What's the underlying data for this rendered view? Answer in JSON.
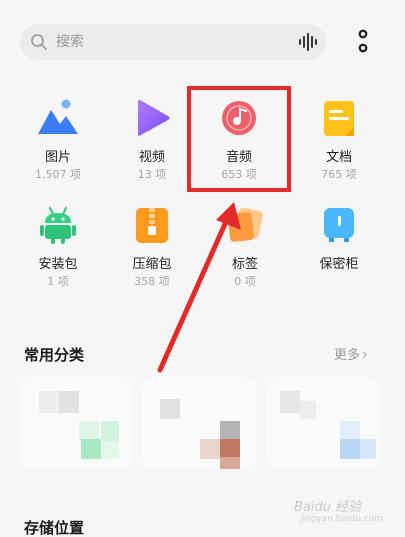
{
  "search": {
    "placeholder": "搜索"
  },
  "categories": [
    {
      "label": "图片",
      "count": "1,507 项",
      "icon": "image-icon"
    },
    {
      "label": "视频",
      "count": "13 项",
      "icon": "video-icon"
    },
    {
      "label": "音频",
      "count": "653 项",
      "icon": "audio-icon"
    },
    {
      "label": "文档",
      "count": "765 项",
      "icon": "document-icon"
    },
    {
      "label": "安装包",
      "count": "1 项",
      "icon": "android-package-icon"
    },
    {
      "label": "压缩包",
      "count": "358 项",
      "icon": "zip-icon"
    },
    {
      "label": "标签",
      "count": "0 项",
      "icon": "tag-icon"
    },
    {
      "label": "保密柜",
      "count": "",
      "icon": "safe-icon"
    }
  ],
  "sections": {
    "common": {
      "title": "常用分类",
      "more": "更多"
    },
    "storage": {
      "title": "存储位置"
    }
  },
  "annotation": {
    "color": "#e52a2a"
  },
  "watermark": {
    "text": "Baidu 经验",
    "sub": "jingyan.baidu.com"
  }
}
